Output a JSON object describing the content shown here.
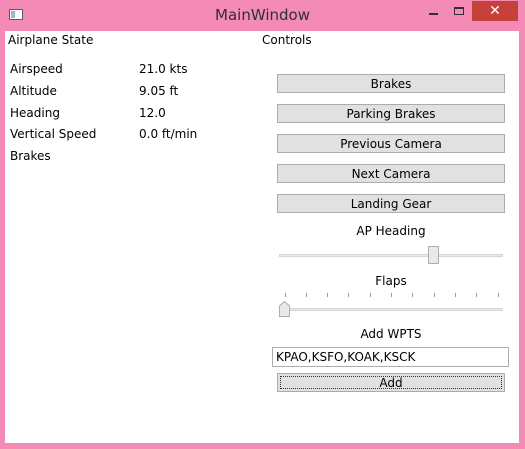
{
  "window": {
    "title": "MainWindow",
    "close_glyph": "✕",
    "frame_color": "#f38bb6"
  },
  "state": {
    "heading": "Airplane State",
    "rows": [
      {
        "label": "Airspeed",
        "value": "21.0 kts"
      },
      {
        "label": "Altitude",
        "value": "9.05 ft"
      },
      {
        "label": "Heading",
        "value": "12.0"
      },
      {
        "label": "Vertical Speed",
        "value": "0.0 ft/min"
      },
      {
        "label": "Brakes",
        "value": ""
      }
    ]
  },
  "controls": {
    "heading": "Controls",
    "buttons": [
      "Brakes",
      "Parking Brakes",
      "Previous Camera",
      "Next Camera",
      "Landing Gear"
    ],
    "ap_heading_label": "AP Heading",
    "ap_heading_fraction": 0.7,
    "flaps_label": "Flaps",
    "flaps_fraction": 0.0,
    "flaps_tick_count": 10,
    "add_wpts_label": "Add WPTS",
    "wpts_value": "KPAO,KSFO,KOAK,KSCK",
    "add_button_label": "Add"
  }
}
